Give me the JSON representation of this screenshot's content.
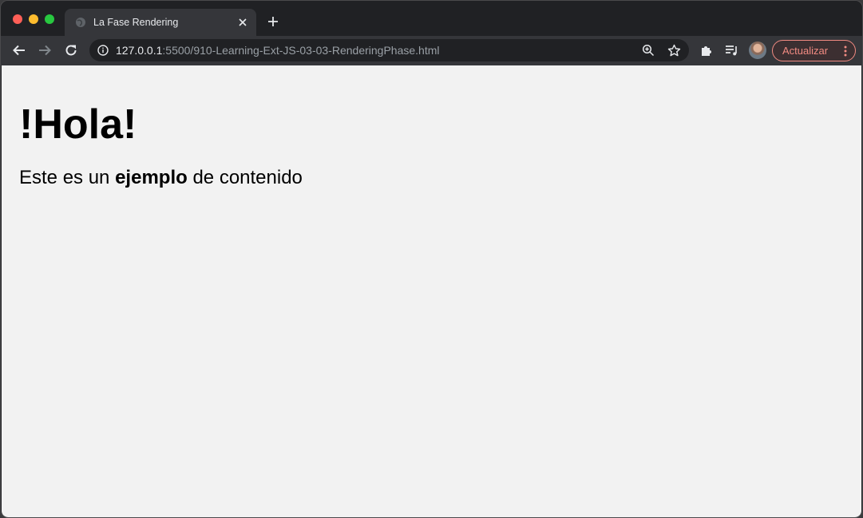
{
  "window": {
    "colors": {
      "close": "#ff5f57",
      "minimize": "#febc2e",
      "zoom": "#28c840"
    }
  },
  "tab": {
    "title": "La Fase Rendering",
    "favicon": "globe-icon"
  },
  "toolbar": {
    "url_host": "127.0.0.1",
    "url_path": ":5500/910-Learning-Ext-JS-03-03-RenderingPhase.html",
    "update_label": "Actualizar",
    "accent_color": "#f28b82"
  },
  "page": {
    "heading": "!Hola!",
    "paragraph": {
      "before": "Este es un ",
      "bold": "ejemplo",
      "after": " de contenido"
    }
  }
}
